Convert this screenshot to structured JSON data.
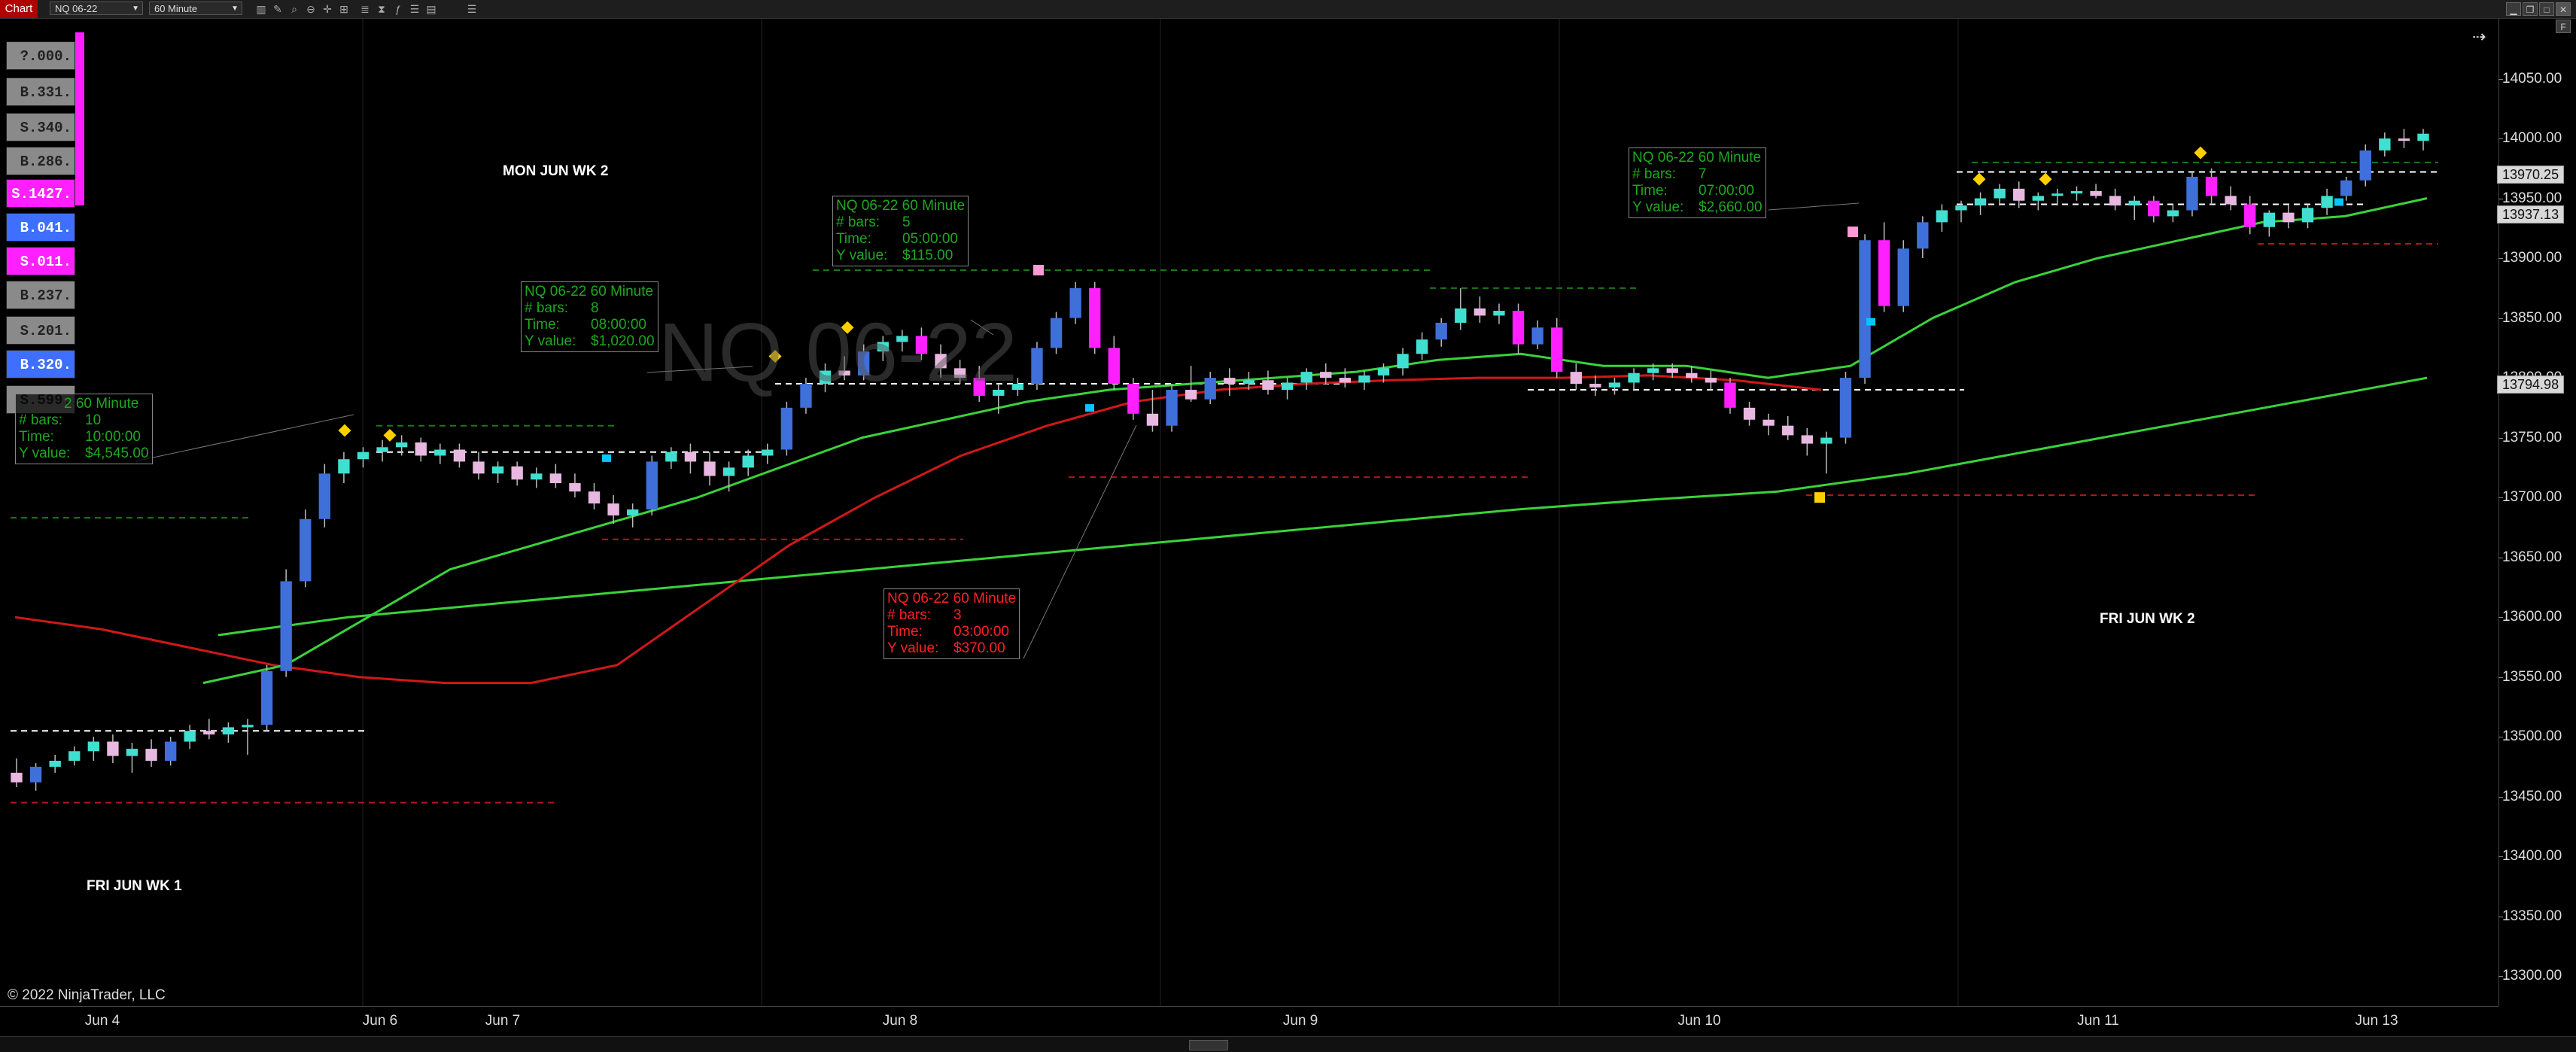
{
  "toolbar": {
    "tab_label": "Chart",
    "instrument": "NQ 06-22",
    "interval": "60 Minute",
    "icons": [
      "bars-icon",
      "pencil-icon",
      "magnify-icon",
      "zoom-out-icon",
      "crosshair-icon",
      "hash-icon",
      "list-icon",
      "hourglass-icon",
      "strategy-icon",
      "properties-icon"
    ],
    "window_buttons": [
      "minimize-icon",
      "restore-icon",
      "close-icon"
    ],
    "extra_button": "F"
  },
  "watermark": "NQ 06-22",
  "day_labels": [
    {
      "text": "MON JUN WK 2"
    },
    {
      "text": "FRI JUN WK 1"
    },
    {
      "text": "FRI JUN WK 2"
    }
  ],
  "panel_cells": [
    {
      "text": "?.000.",
      "color": "#8a8a8a"
    },
    {
      "text": "B.331.",
      "color": "#8a8a8a"
    },
    {
      "text": "S.340.",
      "color": "#8a8a8a"
    },
    {
      "text": "B.286.",
      "color": "#8a8a8a"
    },
    {
      "text": "S.1427.",
      "color": "#ff1fff"
    },
    {
      "text": "B.041.",
      "color": "#3f6fff"
    },
    {
      "text": "S.011.",
      "color": "#ff1fff"
    },
    {
      "text": "B.237.",
      "color": "#8a8a8a"
    },
    {
      "text": "S.201.",
      "color": "#8a8a8a"
    },
    {
      "text": "B.320.",
      "color": "#3f6fff"
    },
    {
      "text": "S.599.",
      "color": "#8a8a8a"
    }
  ],
  "info_boxes": [
    {
      "title": "NQ 06-22 60 Minute",
      "bars_label": "# bars:",
      "bars": "8",
      "time_label": "Time:",
      "time": "08:00:00",
      "y_label": "Y value:",
      "y": "$1,020.00",
      "tone": "green"
    },
    {
      "title": "NQ 06-22 60 Minute",
      "bars_label": "# bars:",
      "bars": "5",
      "time_label": "Time:",
      "time": "05:00:00",
      "y_label": "Y value:",
      "y": "$115.00",
      "tone": "green"
    },
    {
      "title": "NQ 06-22 60 Minute",
      "bars_label": "# bars:",
      "bars": "7",
      "time_label": "Time:",
      "time": "07:00:00",
      "y_label": "Y value:",
      "y": "$2,660.00",
      "tone": "green"
    },
    {
      "title": "2 60 Minute",
      "bars_label": "# bars:",
      "bars": "10",
      "time_label": "Time:",
      "time": "10:00:00",
      "y_label": "Y value:",
      "y": "$4,545.00",
      "tone": "green"
    },
    {
      "title": "NQ 06-22 60 Minute",
      "bars_label": "# bars:",
      "bars": "3",
      "time_label": "Time:",
      "time": "03:00:00",
      "y_label": "Y value:",
      "y": "$370.00",
      "tone": "red"
    }
  ],
  "price_axis": {
    "ticks": [
      "14050.00",
      "14000.00",
      "13950.00",
      "13900.00",
      "13850.00",
      "13800.00",
      "13750.00",
      "13700.00",
      "13650.00",
      "13600.00",
      "13550.00",
      "13500.00",
      "13450.00",
      "13400.00",
      "13350.00",
      "13300.00"
    ],
    "tags": [
      "13970.25",
      "13937.13",
      "13794.98"
    ],
    "tag_values": [
      13970.25,
      13937.13,
      13794.98
    ]
  },
  "time_axis": {
    "ticks": [
      "Jun 4",
      "Jun 6",
      "Jun 7",
      "Jun 8",
      "Jun 9",
      "Jun 10",
      "Jun 11",
      "Jun 13"
    ]
  },
  "copyright": "© 2022 NinjaTrader, LLC",
  "chart_data": {
    "type": "candlestick",
    "instrument": "NQ 06-22",
    "interval": "60 Minute",
    "ylim": [
      13275,
      14100
    ],
    "bull_color": "#3f6fd8",
    "bear_color": "#ff1fff",
    "weak_bull_color": "#40e0d0",
    "weak_bear_color": "#e8b8e0",
    "candles": [
      [
        13470,
        13482,
        13458,
        13462
      ],
      [
        13462,
        13478,
        13455,
        13475
      ],
      [
        13475,
        13485,
        13470,
        13480
      ],
      [
        13480,
        13492,
        13476,
        13488
      ],
      [
        13488,
        13500,
        13480,
        13496
      ],
      [
        13496,
        13502,
        13478,
        13484
      ],
      [
        13484,
        13495,
        13470,
        13490
      ],
      [
        13490,
        13498,
        13475,
        13480
      ],
      [
        13480,
        13500,
        13476,
        13496
      ],
      [
        13496,
        13510,
        13490,
        13505
      ],
      [
        13505,
        13515,
        13498,
        13502
      ],
      [
        13502,
        13512,
        13495,
        13508
      ],
      [
        13508,
        13515,
        13485,
        13510
      ],
      [
        13510,
        13560,
        13505,
        13555
      ],
      [
        13555,
        13640,
        13550,
        13630
      ],
      [
        13630,
        13690,
        13625,
        13682
      ],
      [
        13682,
        13728,
        13675,
        13720
      ],
      [
        13720,
        13738,
        13712,
        13732
      ],
      [
        13732,
        13742,
        13725,
        13738
      ],
      [
        13738,
        13748,
        13730,
        13742
      ],
      [
        13742,
        13752,
        13735,
        13746
      ],
      [
        13746,
        13750,
        13730,
        13735
      ],
      [
        13735,
        13745,
        13728,
        13740
      ],
      [
        13740,
        13745,
        13725,
        13730
      ],
      [
        13730,
        13738,
        13715,
        13720
      ],
      [
        13720,
        13730,
        13712,
        13726
      ],
      [
        13726,
        13730,
        13710,
        13715
      ],
      [
        13715,
        13725,
        13708,
        13720
      ],
      [
        13720,
        13728,
        13708,
        13712
      ],
      [
        13712,
        13720,
        13700,
        13705
      ],
      [
        13705,
        13712,
        13690,
        13695
      ],
      [
        13695,
        13702,
        13678,
        13685
      ],
      [
        13685,
        13695,
        13675,
        13690
      ],
      [
        13690,
        13735,
        13685,
        13730
      ],
      [
        13730,
        13742,
        13724,
        13738
      ],
      [
        13738,
        13745,
        13720,
        13730
      ],
      [
        13730,
        13738,
        13710,
        13718
      ],
      [
        13718,
        13730,
        13705,
        13725
      ],
      [
        13725,
        13740,
        13718,
        13735
      ],
      [
        13735,
        13745,
        13728,
        13740
      ],
      [
        13740,
        13780,
        13735,
        13775
      ],
      [
        13775,
        13800,
        13770,
        13795
      ],
      [
        13795,
        13812,
        13788,
        13806
      ],
      [
        13806,
        13818,
        13798,
        13802
      ],
      [
        13802,
        13828,
        13798,
        13822
      ],
      [
        13822,
        13835,
        13814,
        13830
      ],
      [
        13830,
        13840,
        13822,
        13835
      ],
      [
        13835,
        13842,
        13815,
        13820
      ],
      [
        13820,
        13828,
        13800,
        13808
      ],
      [
        13808,
        13815,
        13795,
        13800
      ],
      [
        13800,
        13810,
        13780,
        13785
      ],
      [
        13785,
        13795,
        13770,
        13790
      ],
      [
        13790,
        13800,
        13785,
        13795
      ],
      [
        13795,
        13830,
        13790,
        13825
      ],
      [
        13825,
        13855,
        13820,
        13850
      ],
      [
        13850,
        13880,
        13845,
        13875
      ],
      [
        13875,
        13880,
        13820,
        13825
      ],
      [
        13825,
        13835,
        13790,
        13795
      ],
      [
        13795,
        13800,
        13765,
        13770
      ],
      [
        13770,
        13790,
        13755,
        13760
      ],
      [
        13760,
        13795,
        13755,
        13790
      ],
      [
        13790,
        13810,
        13780,
        13782
      ],
      [
        13782,
        13805,
        13778,
        13800
      ],
      [
        13800,
        13808,
        13785,
        13795
      ],
      [
        13795,
        13805,
        13790,
        13798
      ],
      [
        13798,
        13806,
        13786,
        13790
      ],
      [
        13790,
        13800,
        13782,
        13796
      ],
      [
        13796,
        13808,
        13790,
        13805
      ],
      [
        13805,
        13812,
        13795,
        13800
      ],
      [
        13800,
        13808,
        13792,
        13796
      ],
      [
        13796,
        13806,
        13790,
        13802
      ],
      [
        13802,
        13812,
        13796,
        13808
      ],
      [
        13808,
        13825,
        13802,
        13820
      ],
      [
        13820,
        13838,
        13815,
        13832
      ],
      [
        13832,
        13850,
        13826,
        13846
      ],
      [
        13846,
        13875,
        13840,
        13858
      ],
      [
        13858,
        13868,
        13846,
        13852
      ],
      [
        13852,
        13862,
        13845,
        13856
      ],
      [
        13856,
        13862,
        13820,
        13828
      ],
      [
        13828,
        13848,
        13824,
        13842
      ],
      [
        13842,
        13850,
        13800,
        13805
      ],
      [
        13805,
        13812,
        13790,
        13795
      ],
      [
        13795,
        13802,
        13785,
        13792
      ],
      [
        13792,
        13800,
        13786,
        13796
      ],
      [
        13796,
        13808,
        13790,
        13804
      ],
      [
        13804,
        13812,
        13798,
        13808
      ],
      [
        13808,
        13812,
        13800,
        13804
      ],
      [
        13804,
        13810,
        13796,
        13800
      ],
      [
        13800,
        13806,
        13790,
        13796
      ],
      [
        13796,
        13800,
        13770,
        13775
      ],
      [
        13775,
        13780,
        13760,
        13765
      ],
      [
        13765,
        13770,
        13752,
        13760
      ],
      [
        13760,
        13768,
        13748,
        13752
      ],
      [
        13752,
        13758,
        13735,
        13745
      ],
      [
        13745,
        13755,
        13720,
        13750
      ],
      [
        13750,
        13805,
        13745,
        13800
      ],
      [
        13800,
        13920,
        13795,
        13915
      ],
      [
        13915,
        13930,
        13855,
        13860
      ],
      [
        13860,
        13915,
        13855,
        13908
      ],
      [
        13908,
        13935,
        13900,
        13930
      ],
      [
        13930,
        13945,
        13922,
        13940
      ],
      [
        13940,
        13948,
        13930,
        13944
      ],
      [
        13944,
        13955,
        13936,
        13950
      ],
      [
        13950,
        13962,
        13944,
        13958
      ],
      [
        13958,
        13964,
        13942,
        13948
      ],
      [
        13948,
        13955,
        13940,
        13952
      ],
      [
        13952,
        13958,
        13944,
        13954
      ],
      [
        13954,
        13960,
        13948,
        13956
      ],
      [
        13956,
        13962,
        13950,
        13952
      ],
      [
        13952,
        13958,
        13940,
        13944
      ],
      [
        13944,
        13952,
        13932,
        13948
      ],
      [
        13948,
        13952,
        13930,
        13935
      ],
      [
        13935,
        13945,
        13930,
        13940
      ],
      [
        13940,
        13972,
        13935,
        13968
      ],
      [
        13968,
        13975,
        13945,
        13952
      ],
      [
        13952,
        13960,
        13940,
        13945
      ],
      [
        13945,
        13952,
        13920,
        13926
      ],
      [
        13926,
        13940,
        13918,
        13938
      ],
      [
        13938,
        13945,
        13925,
        13930
      ],
      [
        13930,
        13945,
        13925,
        13942
      ],
      [
        13942,
        13958,
        13936,
        13952
      ],
      [
        13952,
        13968,
        13948,
        13965
      ],
      [
        13965,
        13995,
        13960,
        13990
      ],
      [
        13990,
        14005,
        13985,
        14000
      ],
      [
        14000,
        14008,
        13992,
        13998
      ],
      [
        13998,
        14008,
        13990,
        14004
      ]
    ],
    "ma_red": [
      13600,
      13590,
      13575,
      13560,
      13550,
      13545,
      13545,
      13560,
      13610,
      13660,
      13700,
      13735,
      13760,
      13780,
      13790,
      13795,
      13798,
      13800,
      13800,
      13802,
      13798,
      13790
    ],
    "ma_green_fast": [
      13545,
      13560,
      13600,
      13640,
      13660,
      13680,
      13700,
      13725,
      13750,
      13765,
      13780,
      13790,
      13795,
      13800,
      13805,
      13815,
      13820,
      13810,
      13810,
      13800,
      13810,
      13850,
      13880,
      13900,
      13915,
      13930,
      13935,
      13950
    ],
    "ma_green_slow": [
      13585,
      13600,
      13610,
      13620,
      13630,
      13640,
      13650,
      13660,
      13670,
      13680,
      13690,
      13698,
      13705,
      13720,
      13740,
      13760,
      13780,
      13800
    ]
  }
}
